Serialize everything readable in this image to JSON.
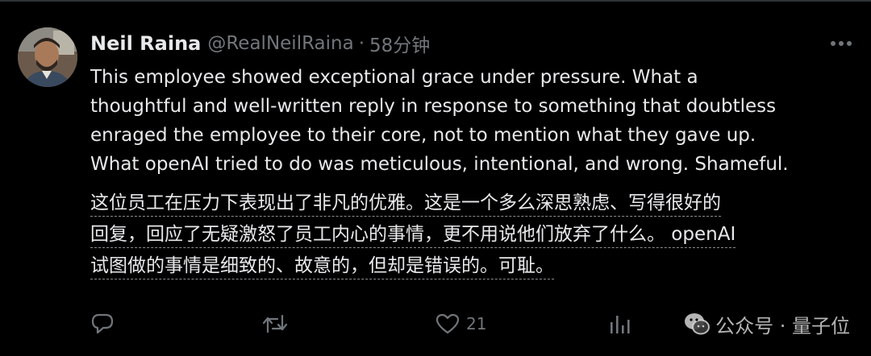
{
  "tweet": {
    "display_name": "Neil Raina",
    "handle": "@RealNeilRaina",
    "separator": "·",
    "time": "58分钟",
    "text_en": [
      "This employee showed exceptional grace under pressure. What a",
      "thoughtful and well-written reply in response to something that doubtless",
      "enraged the employee to their core, not to mention what they gave up.",
      "What openAI tried to do was meticulous, intentional, and wrong. Shameful."
    ],
    "text_zh": [
      "这位员工在压力下表现出了非凡的优雅。这是一个多么深思熟虑、写得很好的",
      "回复，回应了无疑激怒了员工内心的事情，更不用说他们放弃了什么。 openAI",
      "试图做的事情是细致的、故意的，但却是错误的。可耻。"
    ],
    "actions": {
      "reply": {
        "icon": "reply-icon",
        "count": ""
      },
      "retweet": {
        "icon": "retweet-icon",
        "count": ""
      },
      "like": {
        "icon": "heart-icon",
        "count": "21"
      },
      "views": {
        "icon": "views-icon",
        "count": ""
      }
    }
  },
  "watermark": {
    "icon": "wechat-icon",
    "text": "公众号 · 量子位"
  },
  "colors": {
    "background": "#000000",
    "text_primary": "#e7e9ea",
    "text_secondary": "#71767b",
    "divider": "#2f3336"
  }
}
